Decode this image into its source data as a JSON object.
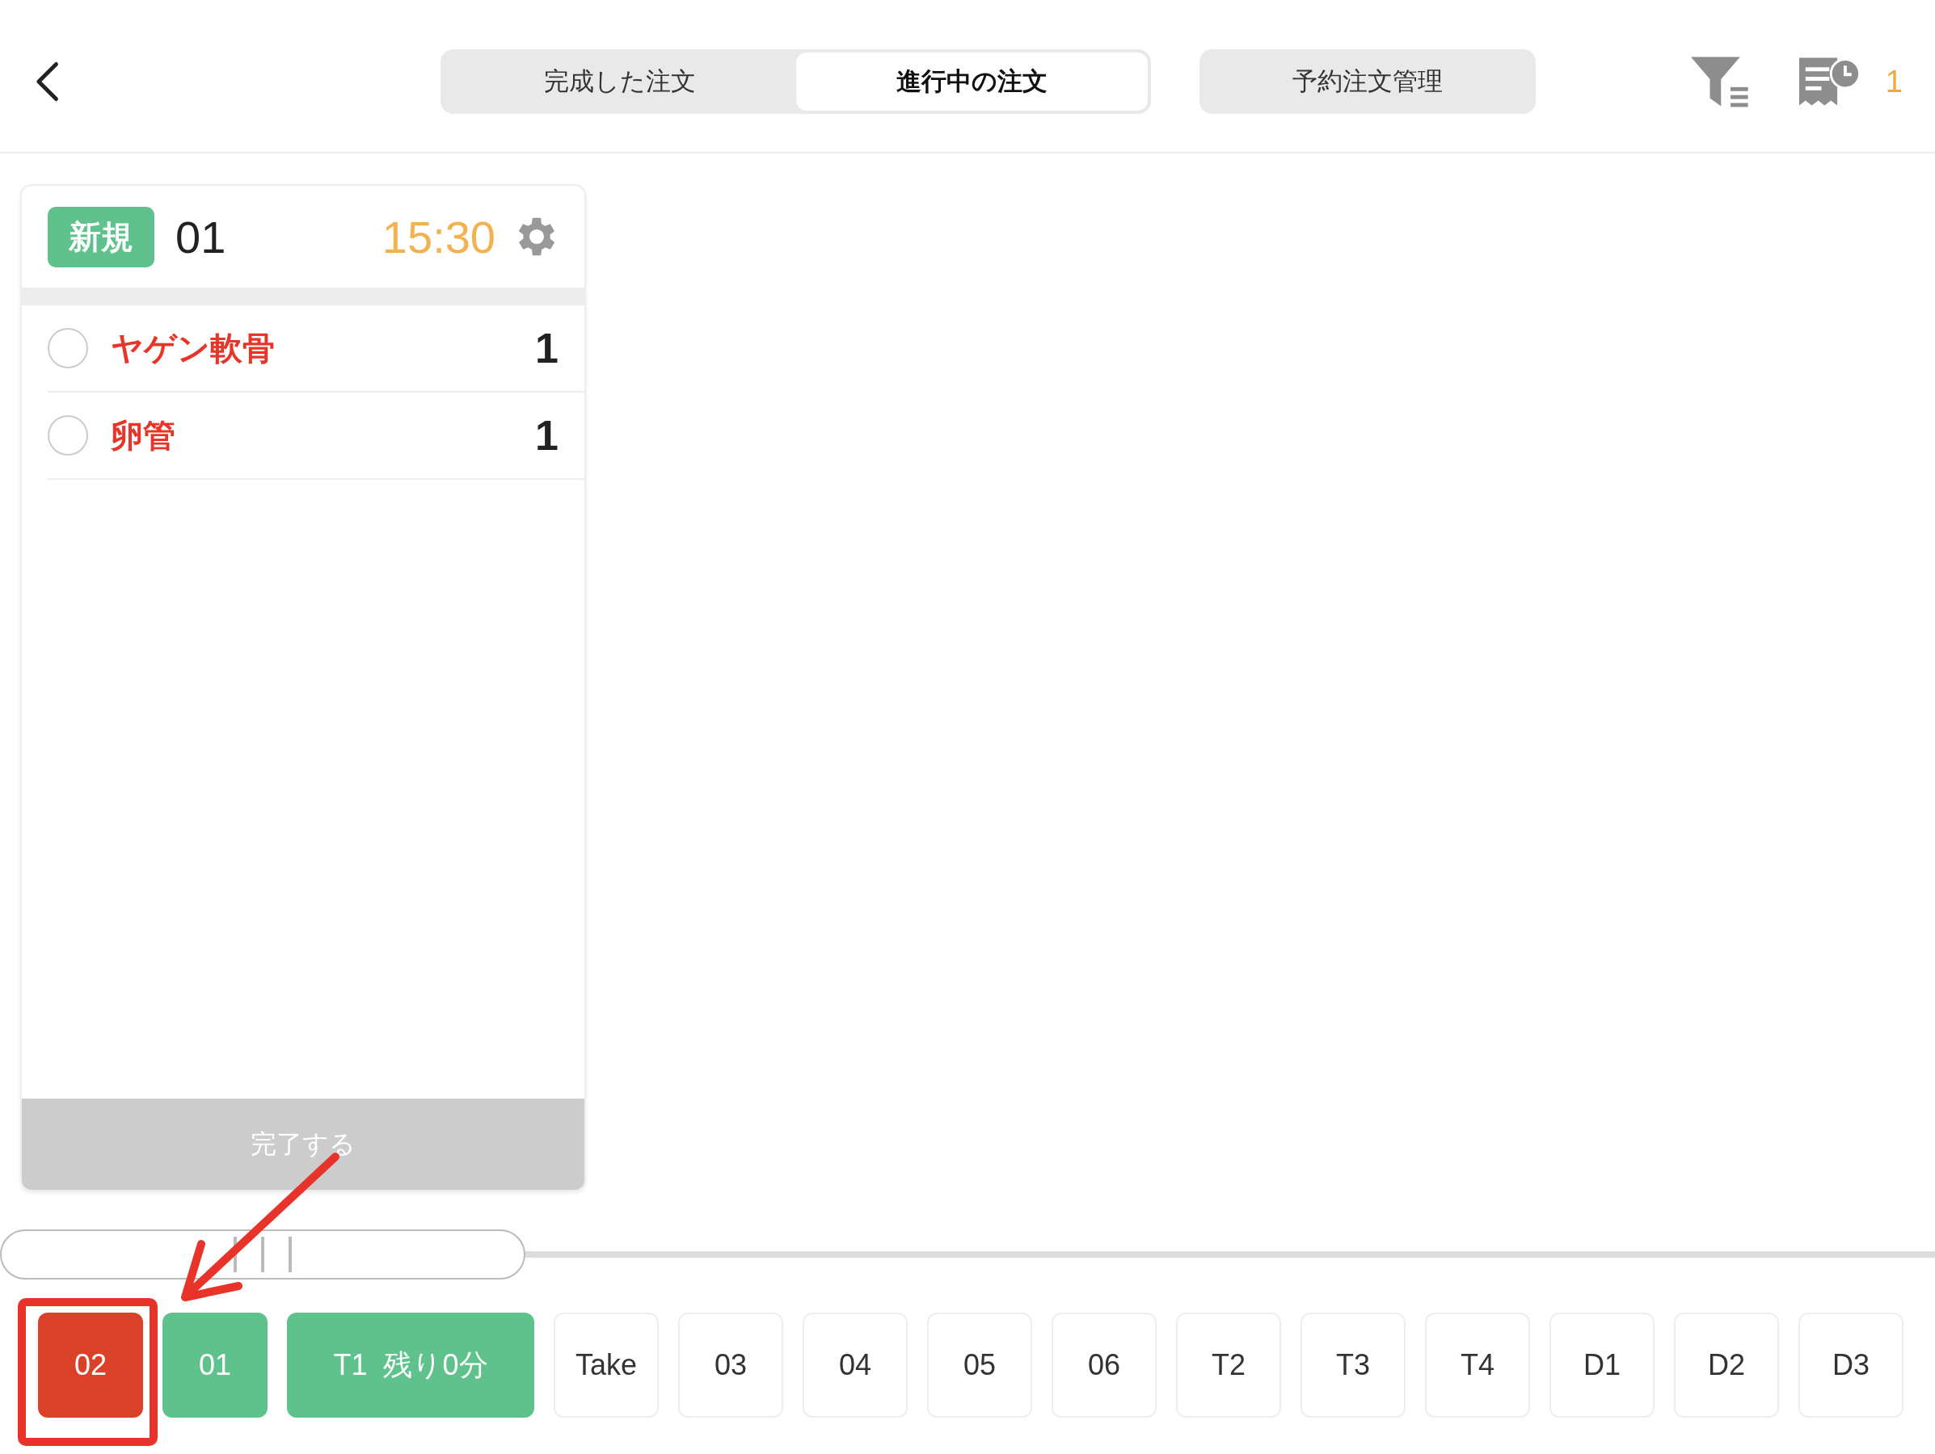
{
  "tabs": [
    {
      "label": "完成した注文",
      "selected": false
    },
    {
      "label": "進行中の注文",
      "selected": true
    }
  ],
  "reservation_button": "予約注文管理",
  "reservation_count": "1",
  "order_card": {
    "badge": "新規",
    "table": "01",
    "time": "15:30",
    "items": [
      {
        "name": "ヤゲン軟骨",
        "quantity": "1",
        "checked": false
      },
      {
        "name": "卵管",
        "quantity": "1",
        "checked": false
      }
    ],
    "complete_button": "完了する"
  },
  "tables": [
    {
      "label": "02",
      "kind": "alert"
    },
    {
      "label": "01",
      "kind": "active"
    },
    {
      "label": "T1  残り0分",
      "kind": "active"
    },
    {
      "label": "Take",
      "kind": "idle"
    },
    {
      "label": "03",
      "kind": "idle"
    },
    {
      "label": "04",
      "kind": "idle"
    },
    {
      "label": "05",
      "kind": "idle"
    },
    {
      "label": "06",
      "kind": "idle"
    },
    {
      "label": "T2",
      "kind": "idle"
    },
    {
      "label": "T3",
      "kind": "idle"
    },
    {
      "label": "T4",
      "kind": "idle"
    },
    {
      "label": "D1",
      "kind": "idle"
    },
    {
      "label": "D2",
      "kind": "idle"
    },
    {
      "label": "D3",
      "kind": "idle"
    }
  ]
}
